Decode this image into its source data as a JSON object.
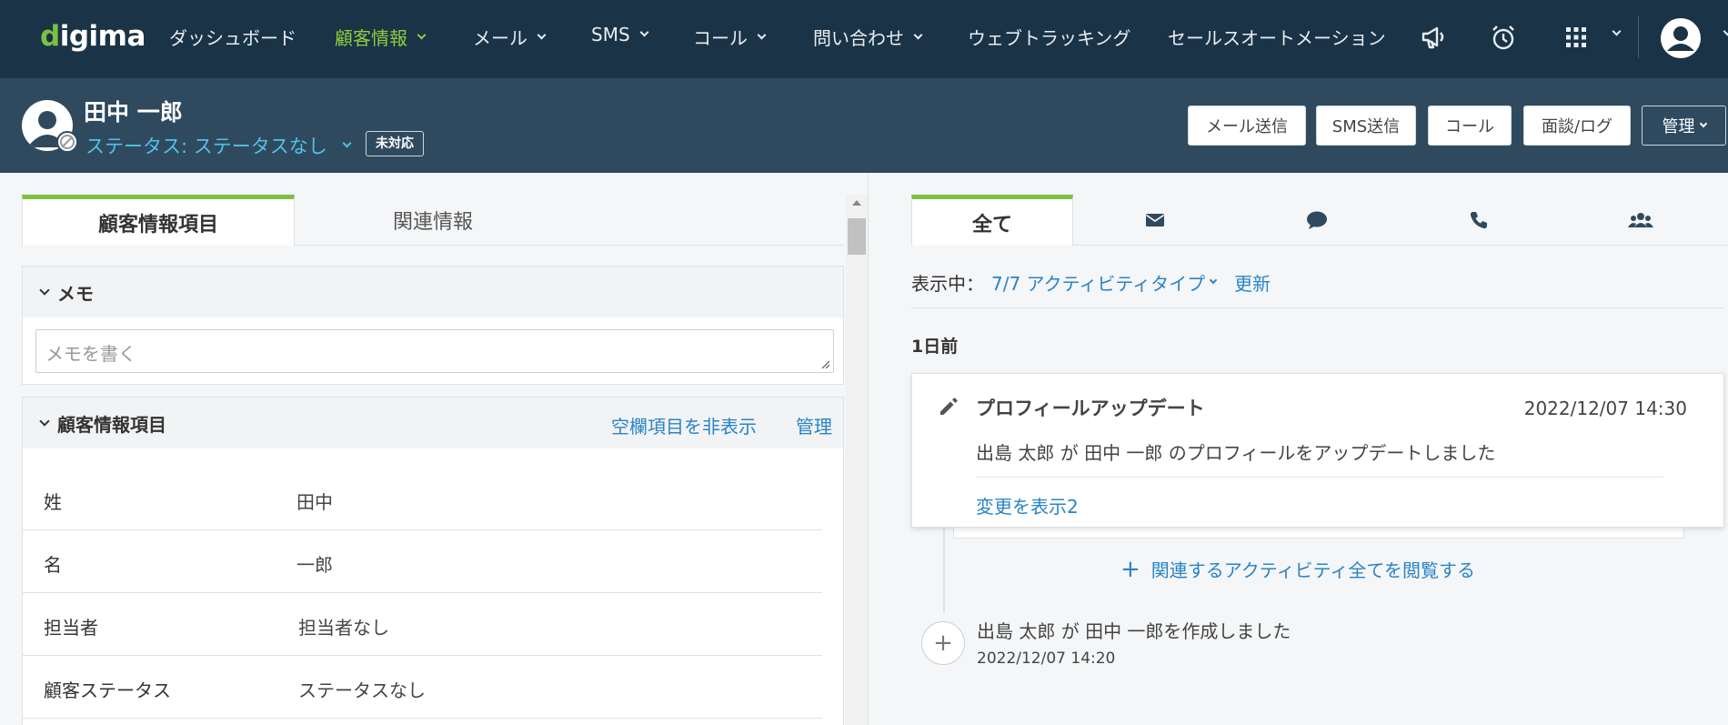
{
  "app": {
    "logo": "digima"
  },
  "nav": {
    "items": [
      {
        "label": "ダッシュボード",
        "dropdown": false
      },
      {
        "label": "顧客情報",
        "dropdown": true,
        "active": true
      },
      {
        "label": "メール",
        "dropdown": true
      },
      {
        "label": "SMS",
        "dropdown": true
      },
      {
        "label": "コール",
        "dropdown": true
      },
      {
        "label": "問い合わせ",
        "dropdown": true
      },
      {
        "label": "ウェブトラッキング",
        "dropdown": false
      },
      {
        "label": "セールスオートメーション",
        "dropdown": false
      }
    ],
    "icons": [
      "megaphone-icon",
      "alarm-clock-icon",
      "apps-grid-icon",
      "user-avatar-icon"
    ]
  },
  "customer": {
    "name": "田中 一郎",
    "status": "ステータス: ステータスなし",
    "badge": "未対応"
  },
  "header_actions": {
    "email": "メール送信",
    "sms": "SMS送信",
    "call": "コール",
    "meeting": "面談/ログ",
    "manage": "管理"
  },
  "left_tabs": {
    "info": "顧客情報項目",
    "related": "関連情報"
  },
  "memo": {
    "title": "メモ",
    "placeholder": "メモを書く"
  },
  "info_section": {
    "title": "顧客情報項目",
    "hide_empty": "空欄項目を非表示",
    "manage": "管理",
    "fields": [
      {
        "label": "姓",
        "value": "田中"
      },
      {
        "label": "名",
        "value": "一郎"
      },
      {
        "label": "担当者",
        "value": "担当者なし"
      },
      {
        "label": "顧客ステータス",
        "value": "ステータスなし"
      }
    ]
  },
  "right_tabs": {
    "all": "全て",
    "icons": [
      "mail-icon",
      "chat-bubble-icon",
      "phone-icon",
      "people-icon"
    ]
  },
  "filter": {
    "prefix": "表示中：",
    "types": "7/7 アクティビティタイプ",
    "refresh": "更新"
  },
  "timeline": {
    "day_label": "1日前",
    "activity": {
      "title": "プロフィールアップデート",
      "time": "2022/12/07 14:30",
      "desc": "出島 太郎 が 田中 一郎 のプロフィールをアップデートしました",
      "link": "変更を表示2"
    },
    "related_link": "関連するアクティビティ全てを閲覧する",
    "created": {
      "text": "出島 太郎 が 田中 一郎を作成しました",
      "time": "2022/12/07 14:20"
    }
  },
  "colors": {
    "nav_bg": "#1b3347",
    "header_bg": "#2f4a5f",
    "accent_green": "#7cc142",
    "link_blue": "#2a84c6",
    "status_cyan": "#53c1e6"
  }
}
